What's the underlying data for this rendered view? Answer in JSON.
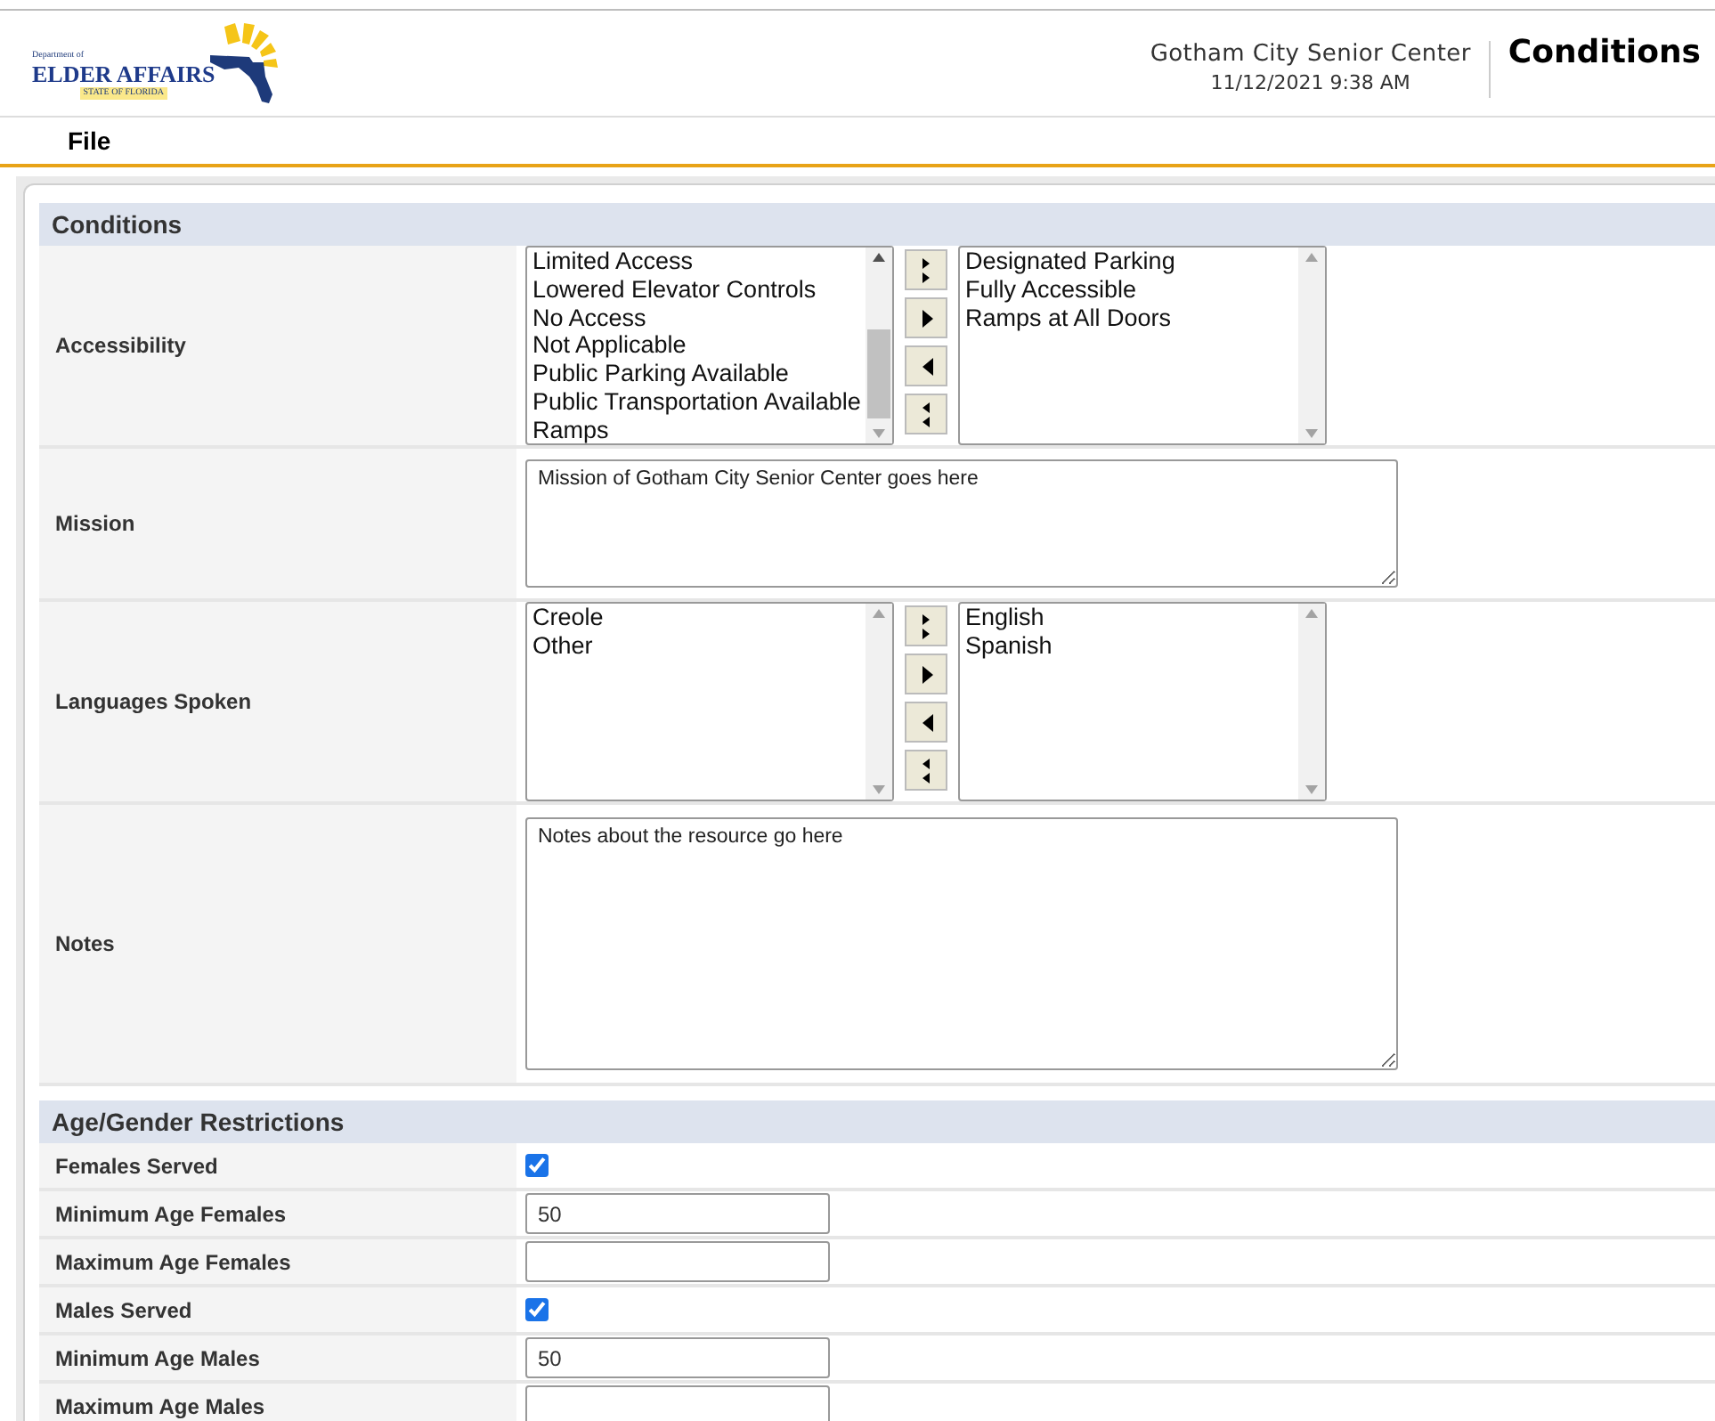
{
  "header": {
    "logo": {
      "top_line": "Department of",
      "name": "ELDER AFFAIRS",
      "state": "STATE OF FLORIDA"
    },
    "organization": "Gotham City Senior Center",
    "datetime": "11/12/2021 9:38 AM",
    "page_title": "Conditions"
  },
  "menu": [
    {
      "label": "File"
    }
  ],
  "sections": [
    {
      "title": "Conditions",
      "rows": [
        {
          "kind": "dual_list",
          "label": "Accessibility",
          "available": [
            "Limited Access",
            "Lowered Elevator Controls",
            "No Access",
            "Not Applicable",
            "Public Parking Available",
            "Public Transportation Available",
            "Ramps"
          ],
          "chosen": [
            "Designated Parking",
            "Fully Accessible",
            "Ramps at All Doors"
          ]
        },
        {
          "kind": "short_textarea",
          "label": "Mission",
          "value": "Mission of Gotham City Senior Center goes here"
        },
        {
          "kind": "dual_list",
          "label": "Languages Spoken",
          "available": [
            "Creole",
            "Other"
          ],
          "chosen": [
            "English",
            "Spanish"
          ]
        },
        {
          "kind": "tall_textarea",
          "label": "Notes",
          "value": "Notes about the resource go here"
        }
      ]
    },
    {
      "title": "Age/Gender Restrictions",
      "rows": [
        {
          "kind": "checkbox",
          "label": "Females Served",
          "checked": true
        },
        {
          "kind": "text_input",
          "label": "Minimum Age Females",
          "value": "50"
        },
        {
          "kind": "text_input",
          "label": "Maximum Age Females"
        },
        {
          "kind": "checkbox",
          "label": "Males Served",
          "checked": true
        },
        {
          "kind": "text_input",
          "label": "Minimum Age Males",
          "value": "50"
        },
        {
          "kind": "text_input",
          "label": "Maximum Age Males"
        }
      ]
    }
  ]
}
